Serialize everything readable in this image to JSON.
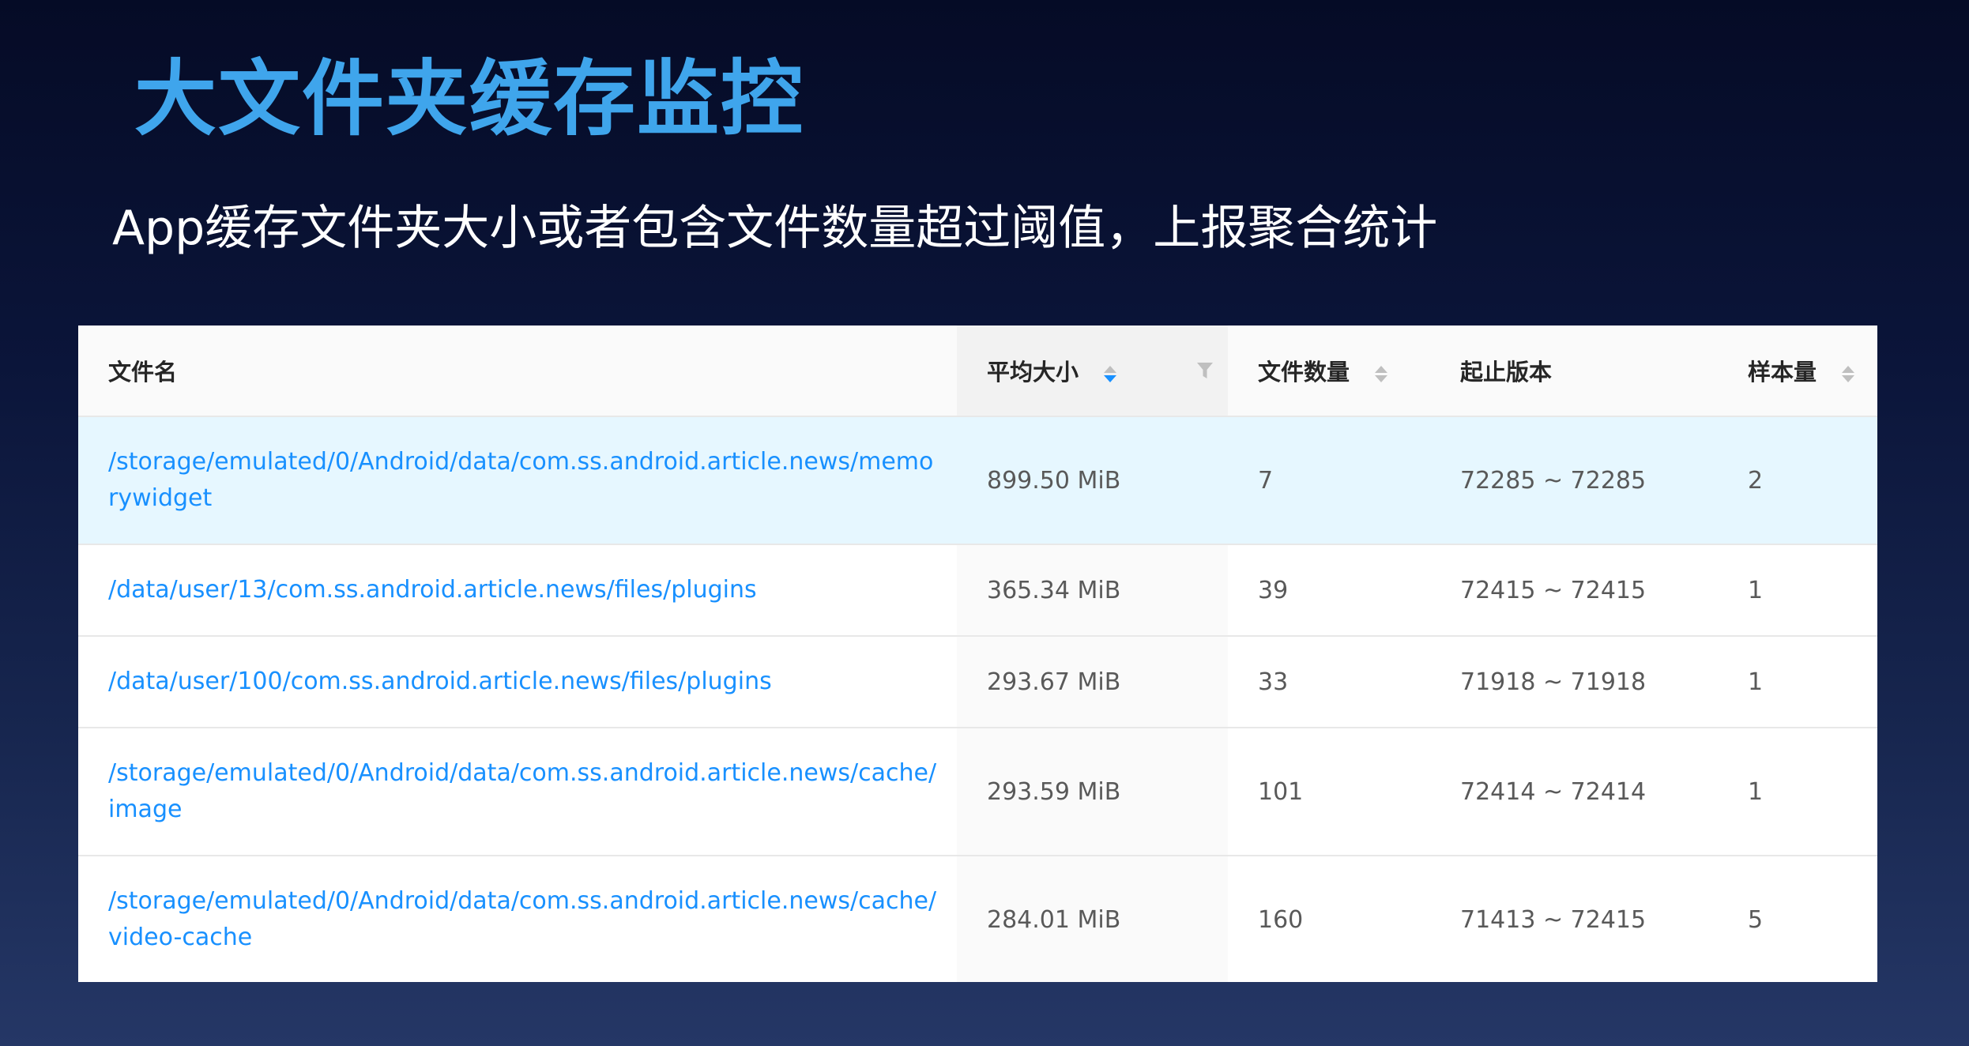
{
  "title": "大文件夹缓存监控",
  "subtitle": "App缓存文件夹大小或者包含文件数量超过阈值，上报聚合统计",
  "colors": {
    "title": "#3fa5ec",
    "link": "#1890ff",
    "active_row": "#e6f7ff",
    "sort_active": "#1890ff",
    "sort_inactive": "#bfbfbf"
  },
  "table": {
    "headers": {
      "name": "文件名",
      "avg_size": "平均大小",
      "file_count": "文件数量",
      "version_range": "起止版本",
      "sample_count": "样本量"
    },
    "sort": {
      "column": "avg_size",
      "direction": "descending"
    },
    "icons": {
      "sort": "sort-caret-icon",
      "filter": "filter-icon"
    },
    "rows": [
      {
        "path": "/storage/emulated/0/Android/data/com.ss.android.article.news/memorywidget",
        "avg_size": "899.50 MiB",
        "file_count": "7",
        "version_range": "72285 ~ 72285",
        "sample_count": "2"
      },
      {
        "path": "/data/user/13/com.ss.android.article.news/files/plugins",
        "avg_size": "365.34 MiB",
        "file_count": "39",
        "version_range": "72415 ~ 72415",
        "sample_count": "1"
      },
      {
        "path": "/data/user/100/com.ss.android.article.news/files/plugins",
        "avg_size": "293.67 MiB",
        "file_count": "33",
        "version_range": "71918 ~ 71918",
        "sample_count": "1"
      },
      {
        "path": "/storage/emulated/0/Android/data/com.ss.android.article.news/cache/image",
        "avg_size": "293.59 MiB",
        "file_count": "101",
        "version_range": "72414 ~ 72414",
        "sample_count": "1"
      },
      {
        "path": "/storage/emulated/0/Android/data/com.ss.android.article.news/cache/video-cache",
        "avg_size": "284.01 MiB",
        "file_count": "160",
        "version_range": "71413 ~ 72415",
        "sample_count": "5"
      }
    ]
  }
}
